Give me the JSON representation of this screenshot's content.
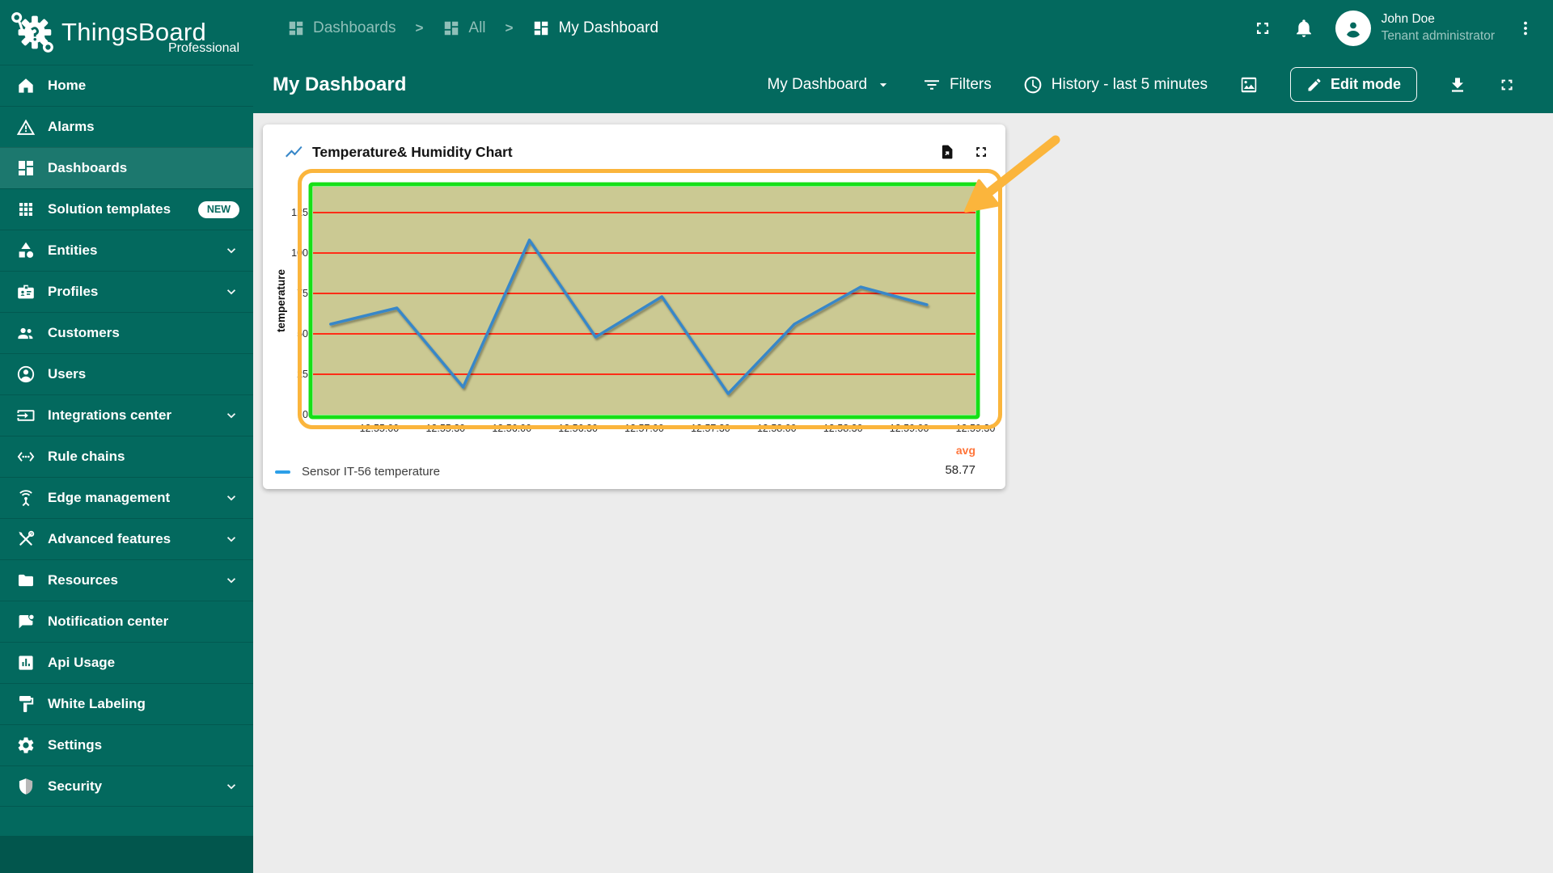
{
  "app": {
    "name": "ThingsBoard",
    "edition": "Professional",
    "logo_icon": "thingsboard-gear-bug"
  },
  "header": {
    "separator": ">",
    "breadcrumbs": [
      {
        "label": "Dashboards",
        "icon": "dashboard",
        "current": false
      },
      {
        "label": "All",
        "icon": "dashboard",
        "current": false
      },
      {
        "label": "My Dashboard",
        "icon": "dashboard",
        "current": true
      }
    ],
    "fullscreen_icon": "fullscreen",
    "notifications_icon": "bell",
    "user": {
      "name": "John Doe",
      "role": "Tenant administrator",
      "avatar_icon": "person"
    },
    "menu_icon": "kebab"
  },
  "toolbar": {
    "title": "My Dashboard",
    "state_selector": {
      "label": "My Dashboard",
      "icon": "caret-down"
    },
    "filters": {
      "label": "Filters",
      "icon": "filter"
    },
    "history": {
      "label": "History - last 5 minutes",
      "icon": "clock"
    },
    "background_icon": "image",
    "edit_button": {
      "label": "Edit mode",
      "icon": "pencil"
    },
    "download_icon": "download",
    "fullscreen_icon": "fullscreen"
  },
  "sidebar": {
    "items": [
      {
        "label": "Home",
        "icon": "home",
        "selected": false,
        "expandable": false,
        "badge": null
      },
      {
        "label": "Alarms",
        "icon": "warning",
        "selected": false,
        "expandable": false,
        "badge": null
      },
      {
        "label": "Dashboards",
        "icon": "dashboard",
        "selected": true,
        "expandable": false,
        "badge": null
      },
      {
        "label": "Solution templates",
        "icon": "apps",
        "selected": false,
        "expandable": false,
        "badge": "NEW"
      },
      {
        "label": "Entities",
        "icon": "category",
        "selected": false,
        "expandable": true,
        "badge": null
      },
      {
        "label": "Profiles",
        "icon": "badge",
        "selected": false,
        "expandable": true,
        "badge": null
      },
      {
        "label": "Customers",
        "icon": "people",
        "selected": false,
        "expandable": false,
        "badge": null
      },
      {
        "label": "Users",
        "icon": "person-circle",
        "selected": false,
        "expandable": false,
        "badge": null
      },
      {
        "label": "Integrations center",
        "icon": "input",
        "selected": false,
        "expandable": true,
        "badge": null
      },
      {
        "label": "Rule chains",
        "icon": "ethernet",
        "selected": false,
        "expandable": false,
        "badge": null
      },
      {
        "label": "Edge management",
        "icon": "antenna",
        "selected": false,
        "expandable": true,
        "badge": null
      },
      {
        "label": "Advanced features",
        "icon": "tools",
        "selected": false,
        "expandable": true,
        "badge": null
      },
      {
        "label": "Resources",
        "icon": "folder",
        "selected": false,
        "expandable": true,
        "badge": null
      },
      {
        "label": "Notification center",
        "icon": "notification",
        "selected": false,
        "expandable": false,
        "badge": null
      },
      {
        "label": "Api Usage",
        "icon": "chart-box",
        "selected": false,
        "expandable": false,
        "badge": null
      },
      {
        "label": "White Labeling",
        "icon": "paint",
        "selected": false,
        "expandable": false,
        "badge": null
      },
      {
        "label": "Settings",
        "icon": "gear",
        "selected": false,
        "expandable": false,
        "badge": null
      },
      {
        "label": "Security",
        "icon": "shield",
        "selected": false,
        "expandable": true,
        "badge": null
      }
    ]
  },
  "widget": {
    "title": "Temperature& Humidity Chart",
    "title_icon": "show-chart",
    "export_icon": "file-export",
    "fullscreen_icon": "fullscreen",
    "legend": {
      "avg_label": "avg",
      "avg_value": "58.77"
    }
  },
  "chart_data": {
    "type": "line",
    "title": "Temperature& Humidity Chart",
    "ylabel": "temperature",
    "xlabel": "",
    "ylim": [
      0,
      141
    ],
    "y_ticks": [
      0,
      25,
      50,
      75,
      100,
      125
    ],
    "x_range": [
      "12:54:30",
      "12:59:30"
    ],
    "x_ticks": [
      "12:55:00",
      "12:55:30",
      "12:56:00",
      "12:56:30",
      "12:57:00",
      "12:57:30",
      "12:58:00",
      "12:58:30",
      "12:59:00",
      "12:59:30"
    ],
    "grid": true,
    "grid_color": "#FF2D16",
    "plot_bg": "#CBC993",
    "legend_position": "bottom-left",
    "series": [
      {
        "name": "Sensor IT-56 temperature",
        "color": "#3787C8",
        "points": [
          {
            "t": "12:54:38",
            "v": 56
          },
          {
            "t": "12:55:08",
            "v": 66
          },
          {
            "t": "12:55:38",
            "v": 17
          },
          {
            "t": "12:56:08",
            "v": 108
          },
          {
            "t": "12:56:38",
            "v": 48
          },
          {
            "t": "12:57:08",
            "v": 73
          },
          {
            "t": "12:57:38",
            "v": 13
          },
          {
            "t": "12:58:08",
            "v": 56
          },
          {
            "t": "12:58:38",
            "v": 79
          },
          {
            "t": "12:59:08",
            "v": 68
          }
        ]
      }
    ],
    "avg": 58.77
  },
  "colors": {
    "primary_teal": "#03695E",
    "content_bg": "#ECECEC",
    "annotation_orange": "#FBB53C",
    "chart_border_green": "#17DF17",
    "chart_plot_bg": "#CBC993",
    "chart_grid_red": "#FF2D16",
    "series_blue": "#3787C8",
    "avg_orange": "#FF7439"
  }
}
